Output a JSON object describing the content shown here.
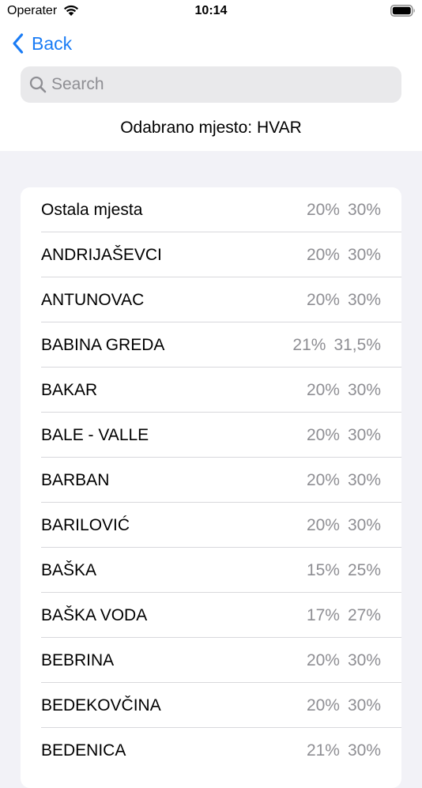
{
  "status_bar": {
    "carrier": "Operater",
    "time": "10:14"
  },
  "nav": {
    "back_label": "Back"
  },
  "search": {
    "placeholder": "Search",
    "value": ""
  },
  "header": {
    "selected_place": "Odabrano mjesto: HVAR"
  },
  "places": [
    {
      "name": "Ostala mjesta",
      "rate_a": "20%",
      "rate_b": "30%"
    },
    {
      "name": "ANDRIJAŠEVCI",
      "rate_a": "20%",
      "rate_b": "30%"
    },
    {
      "name": "ANTUNOVAC",
      "rate_a": "20%",
      "rate_b": "30%"
    },
    {
      "name": "BABINA GREDA",
      "rate_a": "21%",
      "rate_b": "31,5%"
    },
    {
      "name": "BAKAR",
      "rate_a": "20%",
      "rate_b": "30%"
    },
    {
      "name": "BALE - VALLE",
      "rate_a": "20%",
      "rate_b": "30%"
    },
    {
      "name": "BARBAN",
      "rate_a": "20%",
      "rate_b": "30%"
    },
    {
      "name": "BARILOVIĆ",
      "rate_a": "20%",
      "rate_b": "30%"
    },
    {
      "name": "BAŠKA",
      "rate_a": "15%",
      "rate_b": "25%"
    },
    {
      "name": "BAŠKA VODA",
      "rate_a": "17%",
      "rate_b": "27%"
    },
    {
      "name": "BEBRINA",
      "rate_a": "20%",
      "rate_b": "30%"
    },
    {
      "name": "BEDEKOVČINA",
      "rate_a": "20%",
      "rate_b": "30%"
    },
    {
      "name": "BEDENICA",
      "rate_a": "21%",
      "rate_b": "30%"
    }
  ],
  "colors": {
    "accent": "#1a7cf5",
    "secondary_text": "#8e8e93",
    "grouped_background": "#f2f2f7"
  },
  "icons": {
    "back": "chevron-left-icon",
    "search": "magnifying-glass-icon",
    "wifi": "wifi-icon",
    "battery": "battery-icon"
  }
}
